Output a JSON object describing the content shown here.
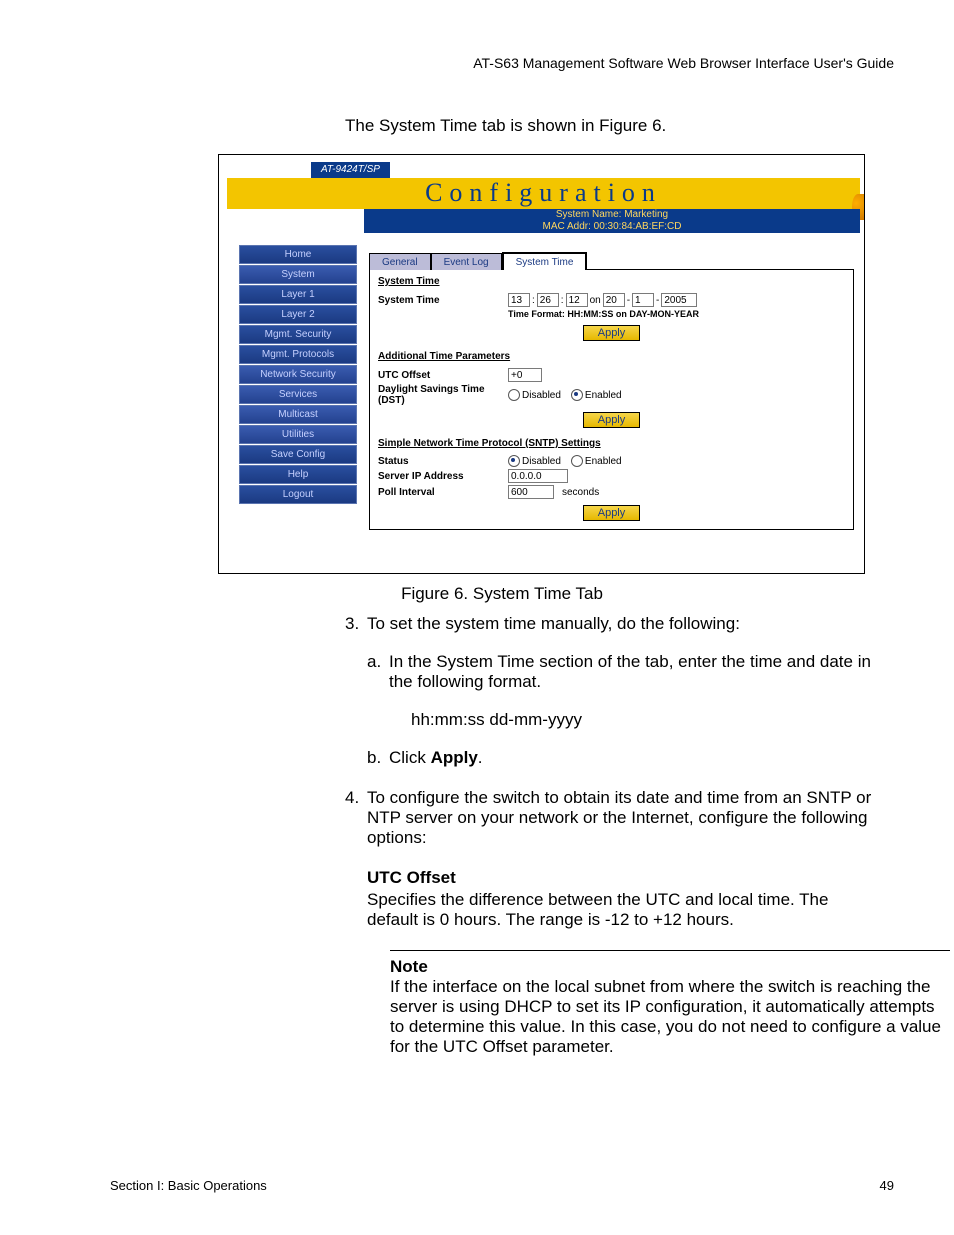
{
  "header": {
    "guide_title": "AT-S63 Management Software Web Browser Interface User's Guide"
  },
  "intro_line": "The System Time tab is shown in Figure 6.",
  "figure_caption": "Figure 6. System Time Tab",
  "step3_num": "3.",
  "step3_text": "To set the system time manually, do the following:",
  "step3a_letter": "a.",
  "step3a_text": "In the System Time section of the tab, enter the time and date in the following format.",
  "time_format_example": "hh:mm:ss dd-mm-yyyy",
  "step3b_letter": "b.",
  "step3b_prefix": "Click ",
  "step3b_bold": "Apply",
  "step3b_suffix": ".",
  "step4_num": "4.",
  "step4_text": "To configure the switch to obtain its date and time from an SNTP or NTP server on your network or the Internet, configure the following options:",
  "utc_heading": "UTC Offset",
  "utc_body": "Specifies the difference between the UTC and local time. The default is 0 hours. The range is -12 to +12 hours.",
  "note_label": "Note",
  "note_body": "If the interface on the local subnet from where the switch is reaching the server is using DHCP to set its IP configuration, it automatically attempts to determine this value. In this case, you do not need to configure a value for the UTC Offset parameter.",
  "footer_left": "Section I: Basic Operations",
  "footer_right": "49",
  "ui": {
    "model": "AT-9424T/SP",
    "title": "Configuration",
    "sysname_l1": "System Name: Marketing",
    "sysname_l2": "MAC Addr: 00:30:84:AB:EF:CD",
    "nav": {
      "home": "Home",
      "system": "System",
      "layer1": "Layer 1",
      "layer2": "Layer 2",
      "mgmt_sec": "Mgmt. Security",
      "mgmt_proto": "Mgmt. Protocols",
      "net_sec": "Network Security",
      "services": "Services",
      "multicast": "Multicast",
      "utilities": "Utilities",
      "save": "Save Config",
      "help": "Help",
      "logout": "Logout"
    },
    "tabs": {
      "general": "General",
      "event_log": "Event Log",
      "system_time": "System Time"
    },
    "section1": {
      "title": "System Time",
      "label": "System Time",
      "hh": "13",
      "mm": "26",
      "ss": "12",
      "on": "on",
      "dd": "20",
      "mon": "1",
      "yyyy": "2005",
      "fmt": "Time Format: HH:MM:SS on DAY-MON-YEAR",
      "apply": "Apply"
    },
    "section2": {
      "title": "Additional Time Parameters",
      "utc_label": "UTC Offset",
      "utc_val": "+0",
      "dst_label": "Daylight Savings Time (DST)",
      "disabled": "Disabled",
      "enabled": "Enabled",
      "apply": "Apply"
    },
    "section3": {
      "title": "Simple Network Time Protocol (SNTP) Settings",
      "status_label": "Status",
      "disabled": "Disabled",
      "enabled": "Enabled",
      "ip_label": "Server IP Address",
      "ip_val": "0.0.0.0",
      "poll_label": "Poll Interval",
      "poll_val": "600",
      "poll_unit": "seconds",
      "apply": "Apply"
    }
  }
}
